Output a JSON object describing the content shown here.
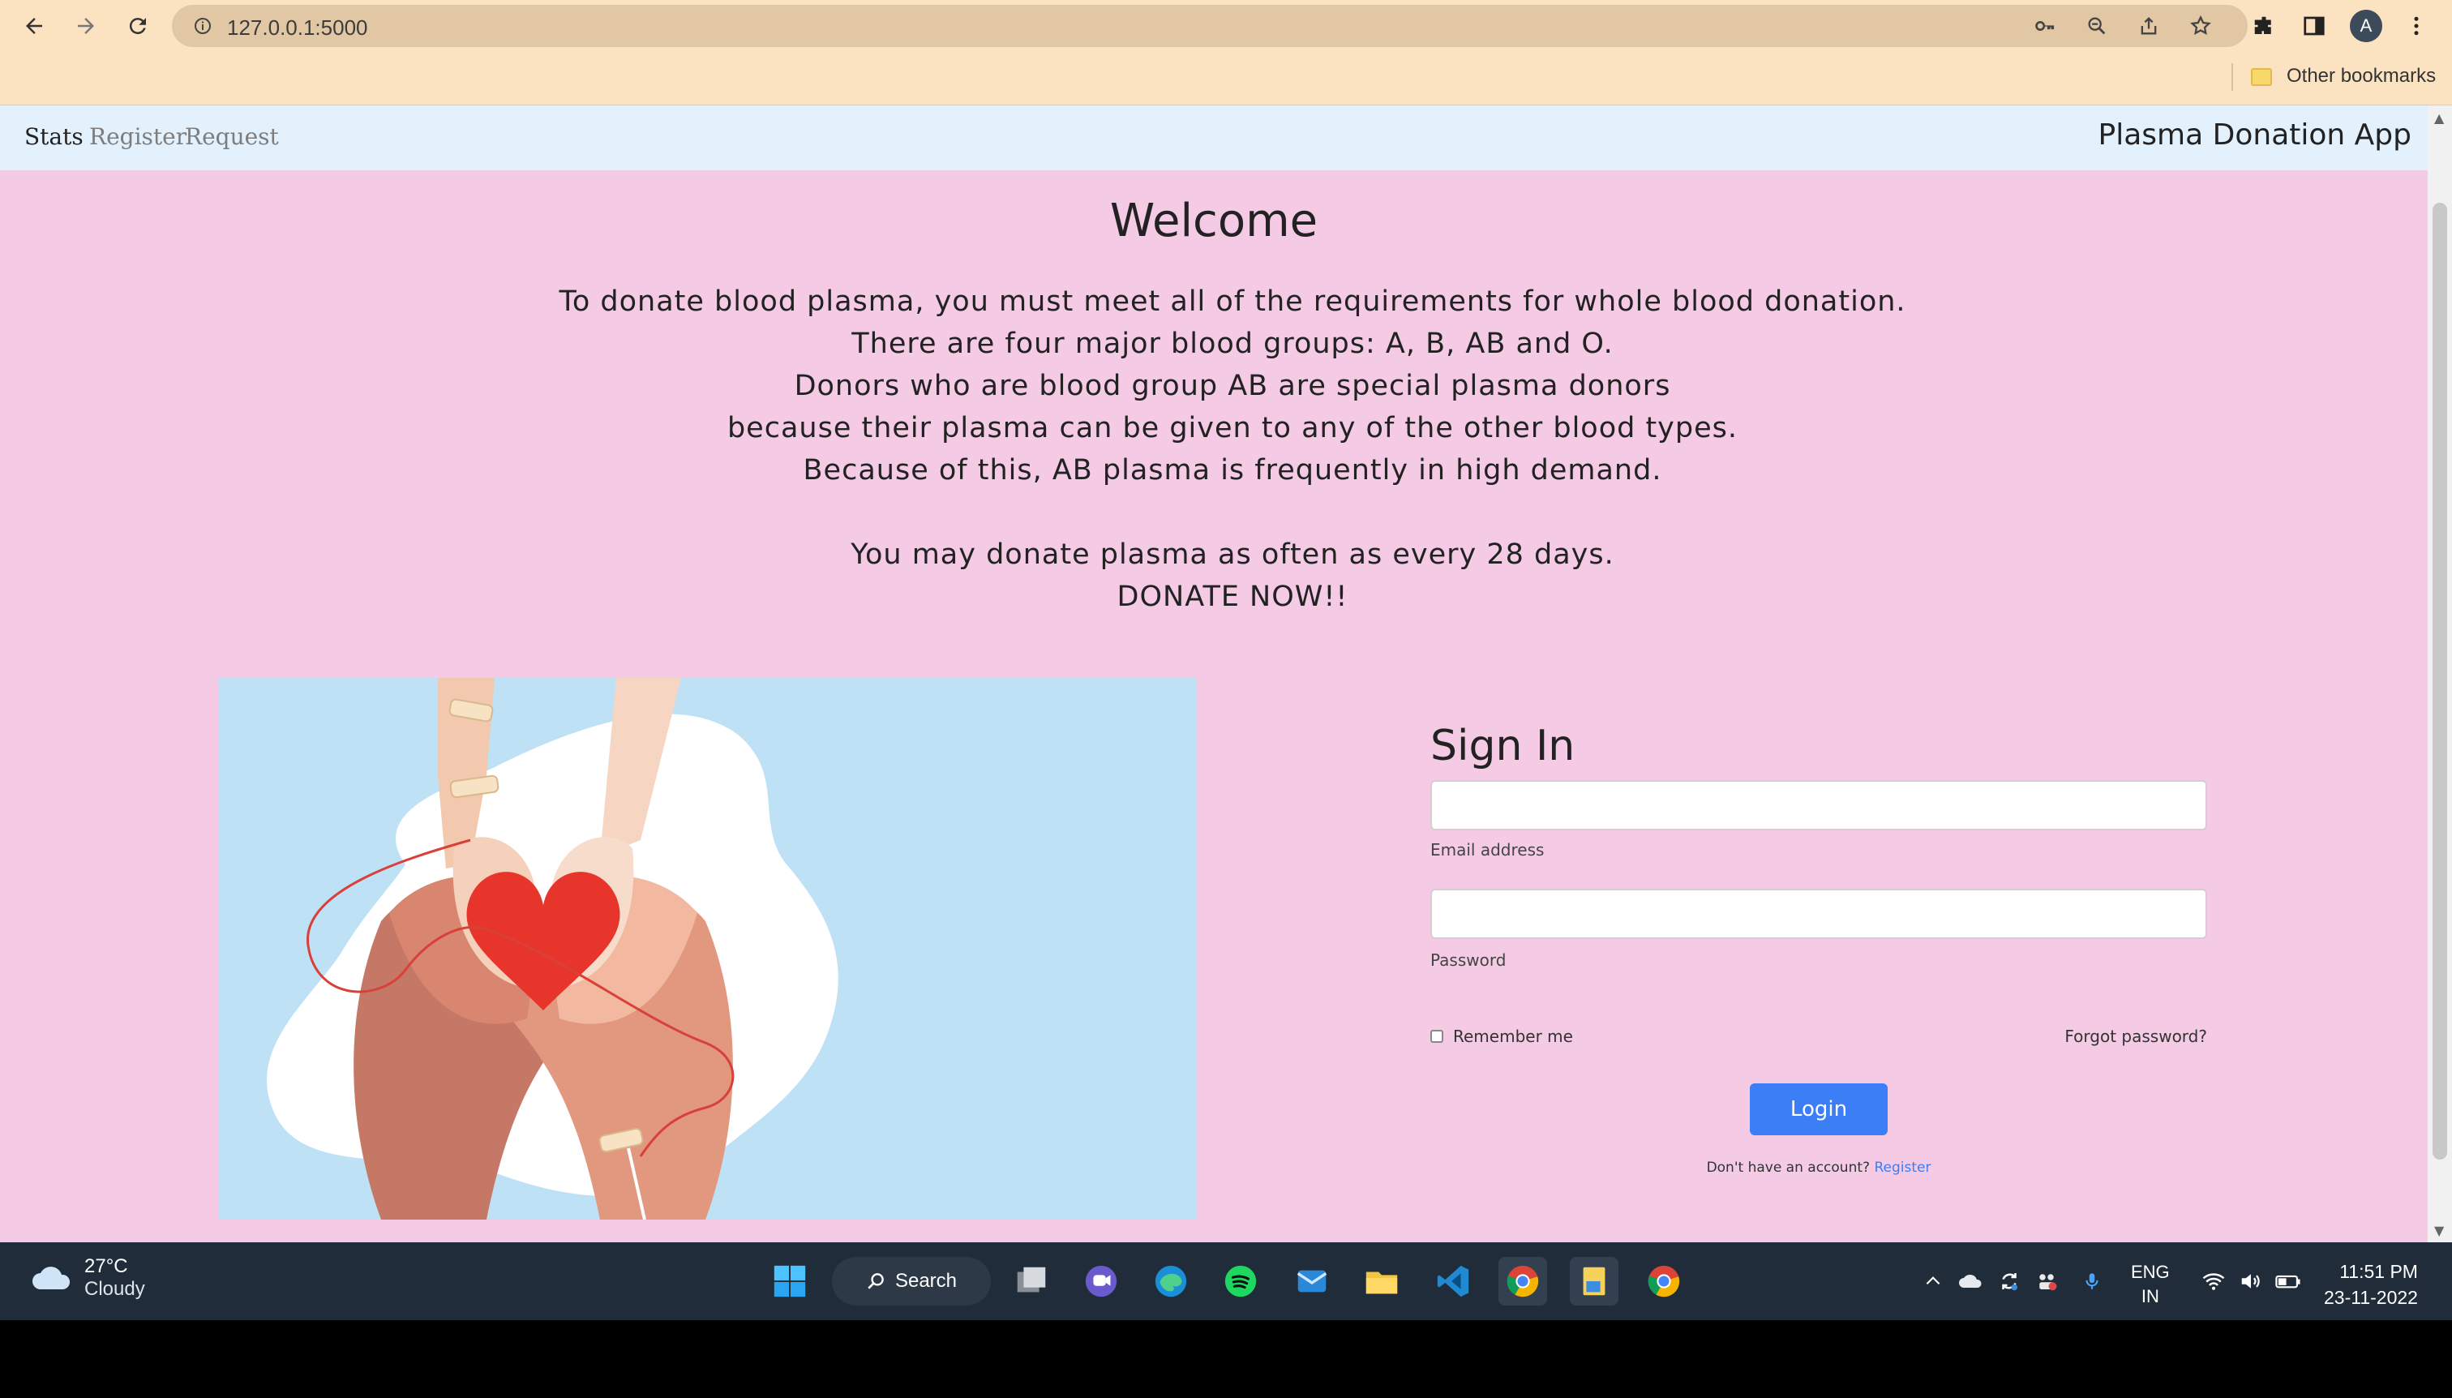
{
  "browser": {
    "url": "127.0.0.1:5000",
    "other_bookmarks": "Other bookmarks",
    "profile_initial": "A"
  },
  "nav": {
    "items": [
      {
        "label": "Stats",
        "active": true
      },
      {
        "label": "Register",
        "active": false
      },
      {
        "label": "Request",
        "active": false
      }
    ],
    "brand": "Plasma Donation App"
  },
  "main": {
    "title": "Welcome",
    "paragraph_lines": [
      "To donate blood plasma, you must meet all of the requirements for whole blood donation.",
      "There are four major blood groups: A, B, AB and O.",
      "Donors who are blood group AB are special plasma donors",
      "because their plasma can be given to any of the other blood types.",
      "Because of this, AB plasma is frequently in high demand.",
      "",
      "You may donate plasma as often as every 28 days.",
      "DONATE NOW!!"
    ]
  },
  "signin": {
    "title": "Sign In",
    "email_label": "Email address",
    "email_value": "",
    "password_label": "Password",
    "password_value": "",
    "remember_label": "Remember me",
    "remember_checked": false,
    "forgot_label": "Forgot password?",
    "login_label": "Login",
    "no_account_text": "Don't have an account?",
    "register_link": "Register"
  },
  "taskbar": {
    "weather_temp": "27°C",
    "weather_condition": "Cloudy",
    "search_label": "Search",
    "lang_line1": "ENG",
    "lang_line2": "IN",
    "time": "11:51 PM",
    "date": "23-11-2022"
  },
  "colors": {
    "page_bg": "#f4cae5",
    "navbar_bg": "#e3f1fc",
    "accent_blue": "#3b7ef5",
    "chrome_bg": "#fbe2c0",
    "hero_bg": "#bfe1f6",
    "heart": "#e8352b"
  }
}
